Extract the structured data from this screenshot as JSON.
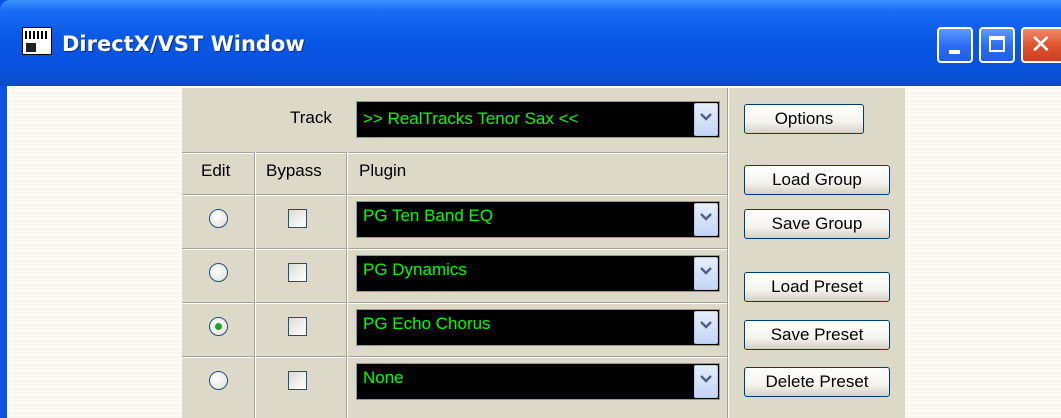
{
  "window": {
    "title": "DirectX/VST Window"
  },
  "track": {
    "label": "Track",
    "value": ">> RealTracks Tenor Sax <<"
  },
  "columns": {
    "edit": "Edit",
    "bypass": "Bypass",
    "plugin": "Plugin"
  },
  "rows": [
    {
      "plugin": "PG Ten Band EQ",
      "edit_selected": false,
      "bypass_checked": false
    },
    {
      "plugin": "PG Dynamics",
      "edit_selected": false,
      "bypass_checked": false
    },
    {
      "plugin": "PG Echo Chorus",
      "edit_selected": true,
      "bypass_checked": false
    },
    {
      "plugin": "None",
      "edit_selected": false,
      "bypass_checked": false
    }
  ],
  "buttons": {
    "options": "Options",
    "load_group": "Load Group",
    "save_group": "Save Group",
    "load_preset": "Load Preset",
    "save_preset": "Save Preset",
    "delete_preset": "Delete Preset"
  },
  "colors": {
    "titlebar": "#0858e6",
    "combo_bg": "#000000",
    "combo_text": "#00ff00",
    "panel": "#ddd9c8",
    "radio_selected": "#21a121"
  },
  "icons": {
    "app": "app-keyboard-icon",
    "minimize": "minimize-icon",
    "maximize": "maximize-icon",
    "close": "close-icon",
    "dropdown": "chevron-down-icon"
  }
}
